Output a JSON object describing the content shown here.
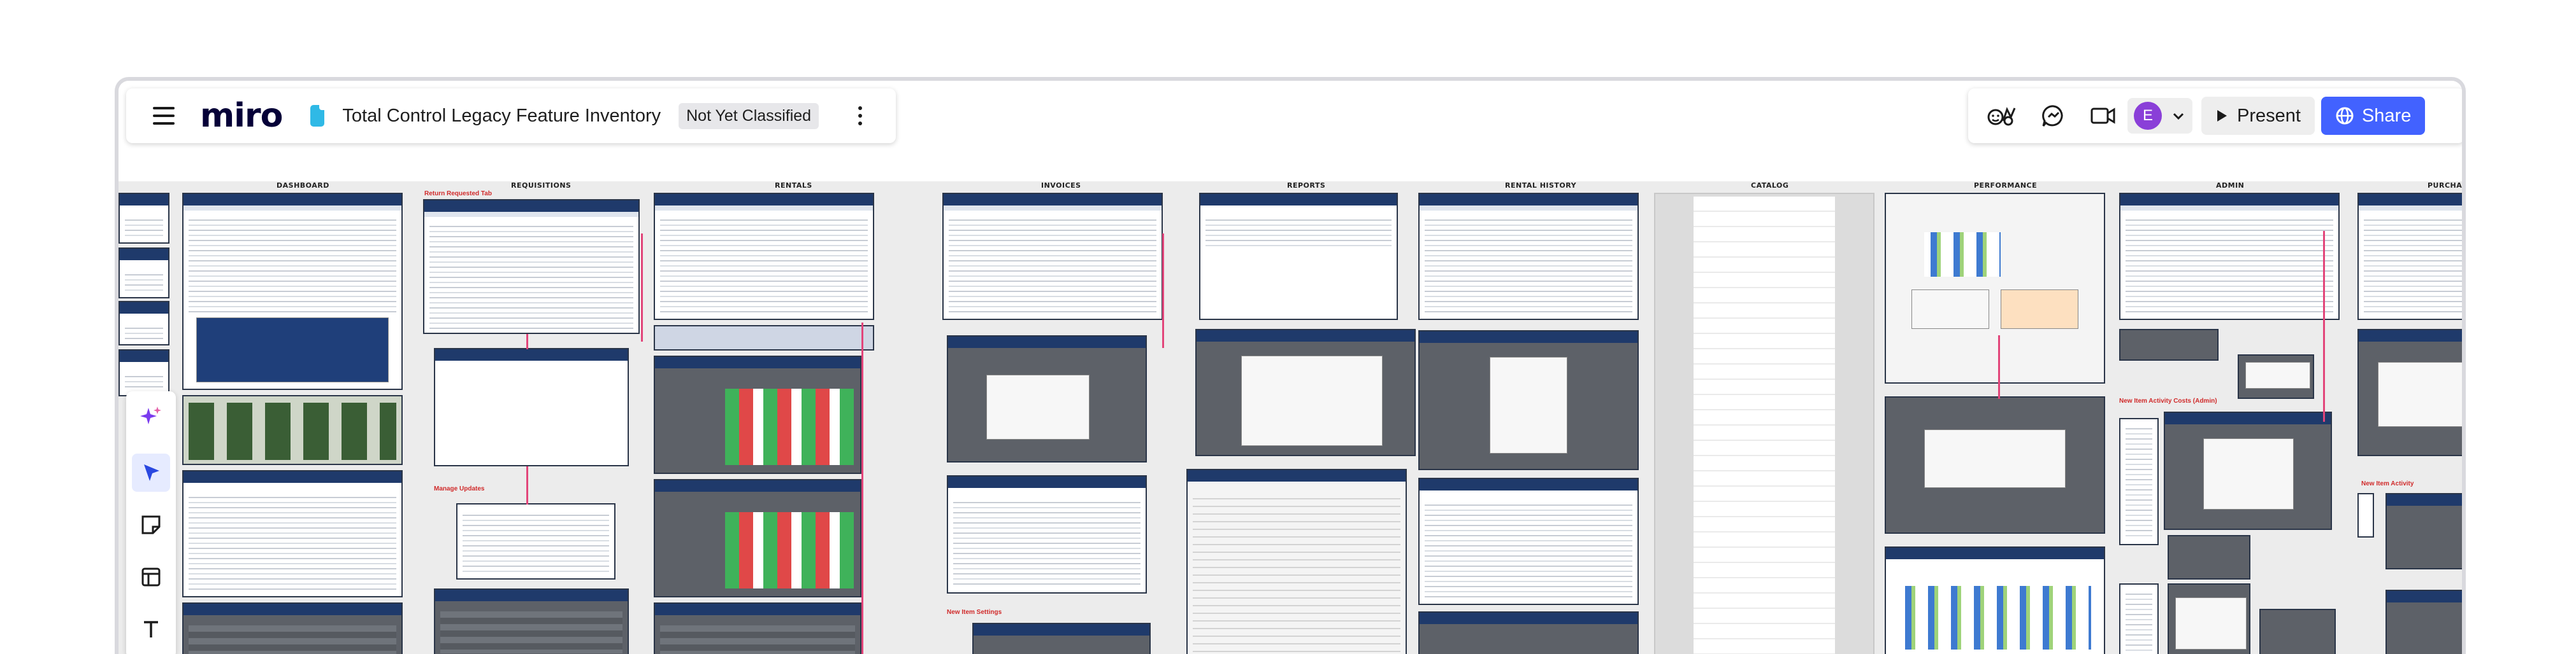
{
  "app": {
    "logo": "miro"
  },
  "board": {
    "name": "Total Control Legacy Feature Inventory",
    "classification": "Not Yet Classified"
  },
  "header_right": {
    "avatar_initial": "E",
    "present_label": "Present",
    "share_label": "Share"
  },
  "colors": {
    "accent": "#4262ff",
    "avatar": "#8a3fd8",
    "link_line": "#e2457a"
  },
  "icons": {
    "reactions": "reactions-icon",
    "comments": "comment-icon",
    "video": "video-icon",
    "play": "play-icon",
    "globe": "globe-icon"
  },
  "tools": [
    "ai-sparkle-icon",
    "select-cursor-icon",
    "sticky-note-icon",
    "template-icon",
    "text-icon"
  ],
  "canvas": {
    "columns": [
      "DASHBOARD",
      "REQUISITIONS",
      "RENTALS",
      "INVOICES",
      "REPORTS",
      "RENTAL HISTORY",
      "CATALOG",
      "PERFORMANCE",
      "ADMIN",
      "PURCHAS"
    ],
    "annotations": {
      "requisitions_top": "Return Requested Tab",
      "requisitions_mid": "Manage Updates",
      "invoices_bottom": "New Item Settings",
      "admin_mid": "New Item Activity Costs (Admin)",
      "purchase_mid": "New Item Activity"
    }
  }
}
